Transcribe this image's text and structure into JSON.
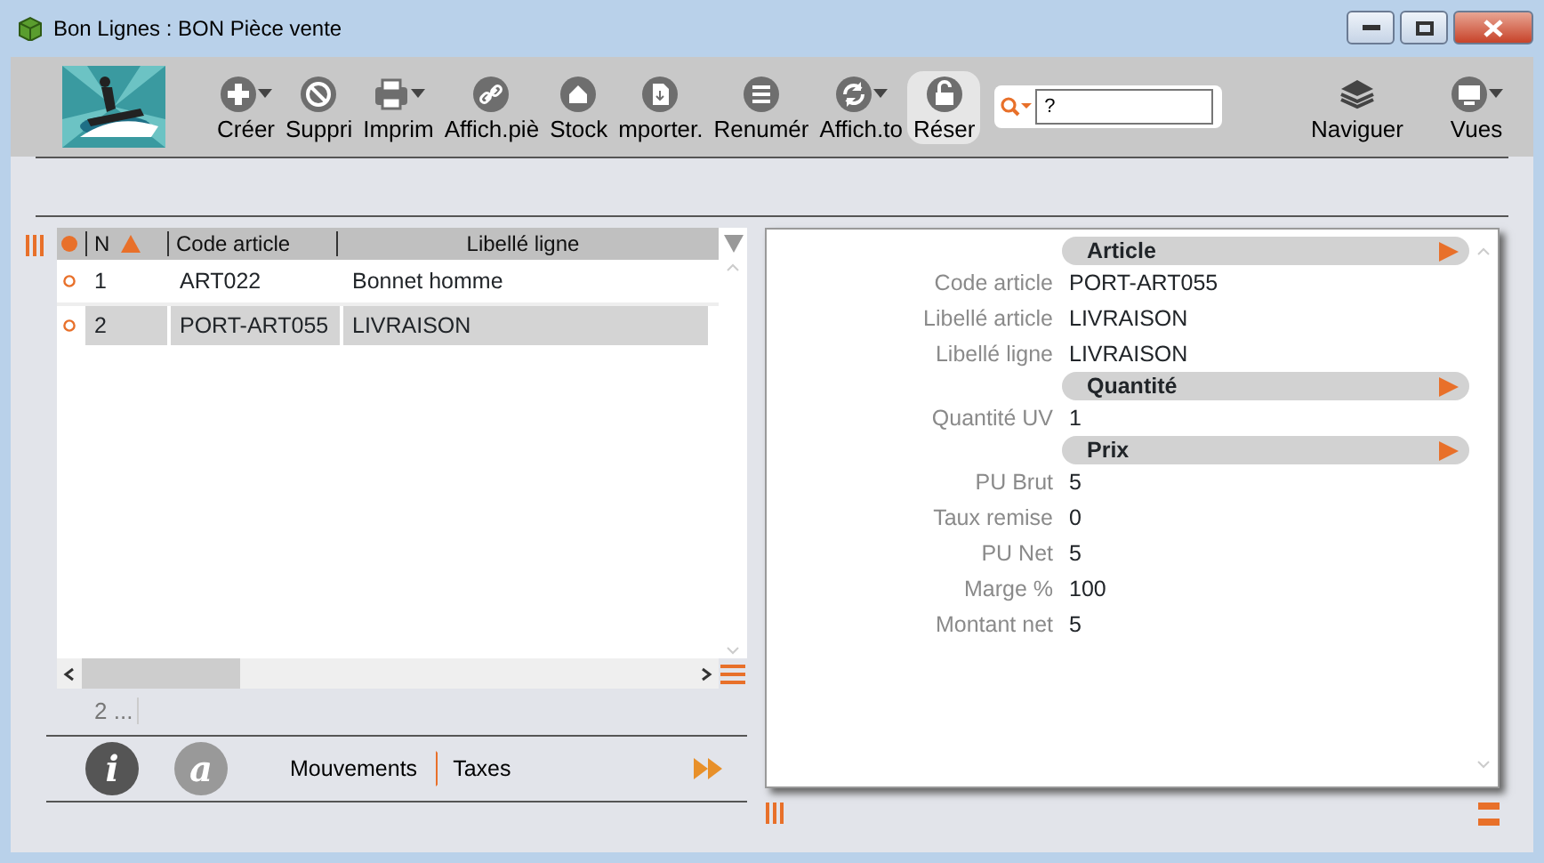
{
  "window": {
    "title": "Bon Lignes : BON Pièce vente"
  },
  "toolbar": {
    "items": [
      {
        "label": "Créer",
        "menu": true,
        "selected": false
      },
      {
        "label": "Suppri",
        "menu": false,
        "selected": false
      },
      {
        "label": "Imprim",
        "menu": true,
        "selected": false
      },
      {
        "label": "Affich.piè",
        "menu": false,
        "selected": false
      },
      {
        "label": "Stock",
        "menu": false,
        "selected": false
      },
      {
        "label": "mporter.",
        "menu": false,
        "selected": false
      },
      {
        "label": "Renumér",
        "menu": false,
        "selected": false
      },
      {
        "label": "Affich.to",
        "menu": true,
        "selected": false
      },
      {
        "label": "Réser",
        "menu": false,
        "selected": true
      }
    ],
    "search": {
      "value": "?"
    },
    "right_items": [
      {
        "label": "Naviguer",
        "menu": false
      },
      {
        "label": "Vues",
        "menu": true
      }
    ]
  },
  "table": {
    "columns": [
      "N",
      "Code article",
      "Libellé ligne"
    ],
    "rows": [
      {
        "n": "1",
        "code": "ART022",
        "label": "Bonnet homme",
        "selected": false
      },
      {
        "n": "2",
        "code": "PORT-ART055",
        "label": "LIVRAISON",
        "selected": true
      }
    ],
    "count": "2 ..."
  },
  "side_buttons": [
    "i",
    "a"
  ],
  "bottom_tabs": [
    "Mouvements",
    "Taxes"
  ],
  "detail": {
    "sections": [
      {
        "title": "Article",
        "fields": [
          {
            "label": "Code article",
            "value": "PORT-ART055"
          },
          {
            "label": "Libellé article",
            "value": "LIVRAISON"
          },
          {
            "label": "Libellé ligne",
            "value": "LIVRAISON"
          }
        ]
      },
      {
        "title": "Quantité",
        "fields": [
          {
            "label": "Quantité UV",
            "value": "1"
          }
        ]
      },
      {
        "title": "Prix",
        "fields": [
          {
            "label": "PU Brut",
            "value": "5"
          },
          {
            "label": "Taux remise",
            "value": "0"
          },
          {
            "label": "PU Net",
            "value": "5"
          },
          {
            "label": "Marge %",
            "value": "100"
          },
          {
            "label": "Montant net",
            "value": "5"
          }
        ]
      }
    ]
  }
}
